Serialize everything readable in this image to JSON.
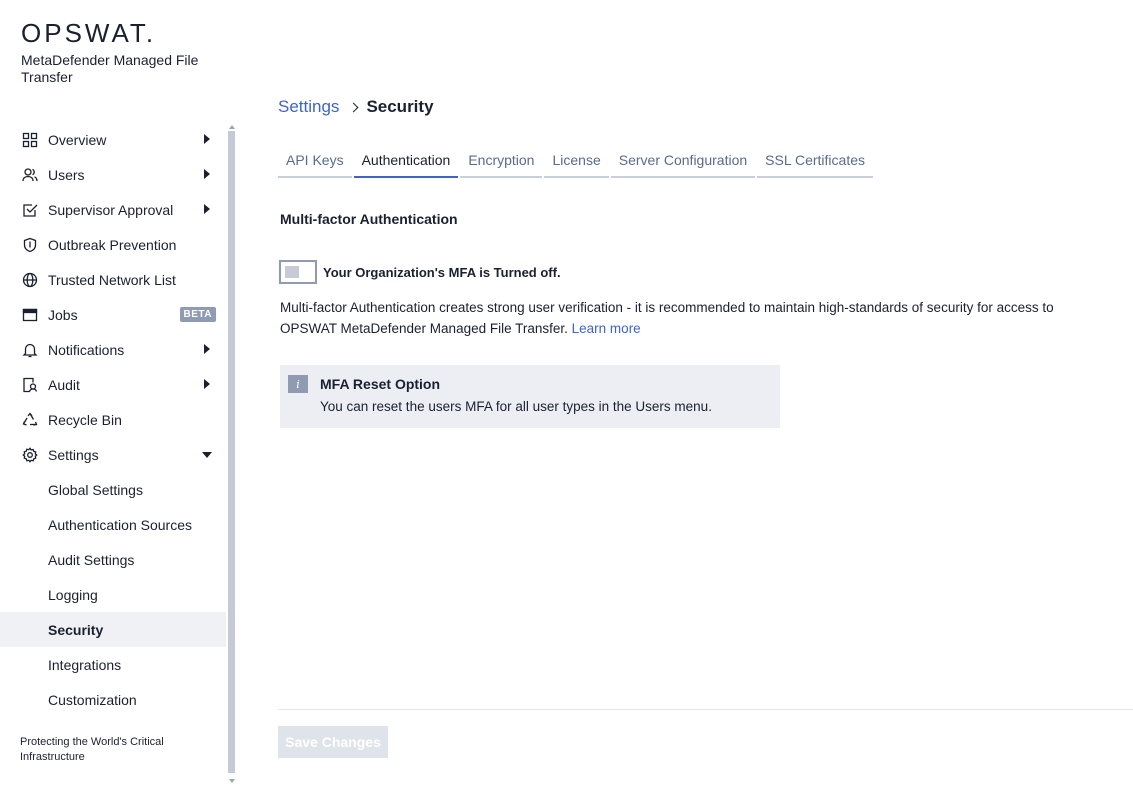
{
  "brand": {
    "logo": "OPSWAT.",
    "product": "MetaDefender Managed File Transfer"
  },
  "sidebar": {
    "items": [
      {
        "label": "Overview",
        "icon": "grid-icon",
        "arrow": "right"
      },
      {
        "label": "Users",
        "icon": "users-icon",
        "arrow": "right"
      },
      {
        "label": "Supervisor Approval",
        "icon": "checkbox-icon",
        "arrow": "right"
      },
      {
        "label": "Outbreak Prevention",
        "icon": "shield-icon"
      },
      {
        "label": "Trusted Network List",
        "icon": "globe-icon"
      },
      {
        "label": "Jobs",
        "icon": "window-icon",
        "badge": "BETA"
      },
      {
        "label": "Notifications",
        "icon": "bell-icon",
        "arrow": "right"
      },
      {
        "label": "Audit",
        "icon": "audit-icon",
        "arrow": "right"
      },
      {
        "label": "Recycle Bin",
        "icon": "recycle-icon"
      },
      {
        "label": "Settings",
        "icon": "gear-icon",
        "arrow": "down"
      }
    ],
    "settings_sub": [
      {
        "label": "Global Settings"
      },
      {
        "label": "Authentication Sources"
      },
      {
        "label": "Audit Settings"
      },
      {
        "label": "Logging"
      },
      {
        "label": "Security",
        "active": true
      },
      {
        "label": "Integrations"
      },
      {
        "label": "Customization"
      }
    ],
    "tagline": "Protecting the World's Critical Infrastructure"
  },
  "breadcrumb": {
    "parent": "Settings",
    "current": "Security"
  },
  "tabs": [
    {
      "label": "API Keys"
    },
    {
      "label": "Authentication",
      "active": true
    },
    {
      "label": "Encryption"
    },
    {
      "label": "License"
    },
    {
      "label": "Server Configuration"
    },
    {
      "label": "SSL Certificates"
    }
  ],
  "mfa": {
    "title": "Multi-factor Authentication",
    "toggle_label": "Your Organization's MFA is Turned off.",
    "toggle_on": false,
    "description": "Multi-factor Authentication creates strong user verification - it is recommended to maintain high-standards of security for access to OPSWAT MetaDefender Managed File Transfer.",
    "learn_more": "Learn more"
  },
  "info": {
    "icon": "info-icon",
    "icon_glyph": "i",
    "title": "MFA Reset Option",
    "text": "You can reset the users MFA for all user types in the Users menu."
  },
  "footer": {
    "save_label": "Save Changes"
  },
  "colors": {
    "accent": "#3d64c9",
    "text": "#1b2030",
    "muted": "#8f9ab3"
  }
}
